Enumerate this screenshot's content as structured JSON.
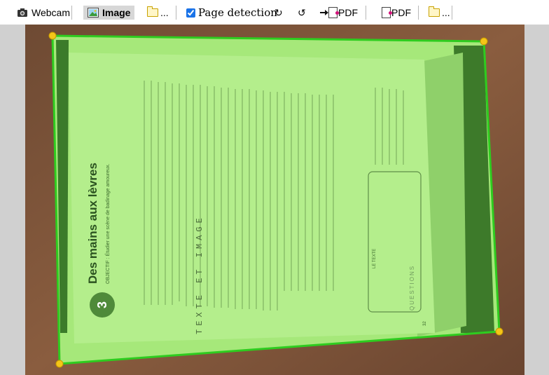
{
  "toolbar": {
    "webcam_label": "Webcam",
    "image_label": "Image",
    "open_label": "...",
    "page_detection_label": "Page detection",
    "page_detection_checked": true,
    "rotate_cw_glyph": "↻",
    "rotate_ccw_glyph": "↺",
    "export_pdf_label": "PDF",
    "save_pdf_label": "PDF",
    "folder2_label": "...",
    "icons": {
      "webcam": "camera-icon",
      "image": "image-icon",
      "open": "folder-icon",
      "rotate_cw": "rotate-clockwise-icon",
      "rotate_ccw": "rotate-counterclockwise-icon",
      "export_pdf": "arrow-to-pdf-icon",
      "save_pdf": "pdf-document-icon",
      "folder2": "folder-icon"
    }
  },
  "book_page": {
    "header": "TEXTE ET IMAGE",
    "chapter_number": "3",
    "title": "Des mains aux lèvres",
    "objective": "OBJECTIF : Étudier une scène de badinage amoureux.",
    "section": "LE TEXTE",
    "questions_label": "QUESTIONS",
    "page_number": "32"
  },
  "detection": {
    "outline_color": "#2ecc1f",
    "handle_color": "#f5c518",
    "overlay_color": "#a6e87a"
  }
}
